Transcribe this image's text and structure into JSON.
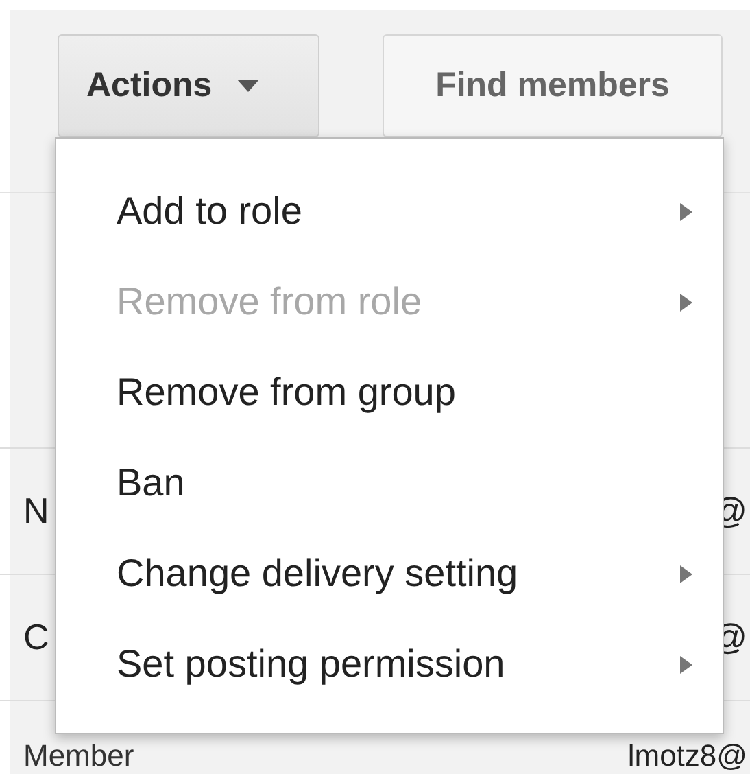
{
  "toolbar": {
    "buttons": [
      {
        "kind": "dropdown",
        "label": "Actions",
        "selected": true
      },
      {
        "kind": "plain",
        "label": "Find members",
        "selected": false
      }
    ]
  },
  "menu": {
    "items": [
      {
        "label": "Add to role",
        "disabled": false,
        "submenu": true
      },
      {
        "label": "Remove from role",
        "disabled": true,
        "submenu": true
      },
      {
        "label": "Remove from group",
        "disabled": false,
        "submenu": false
      },
      {
        "label": "Ban",
        "disabled": false,
        "submenu": false
      },
      {
        "label": "Change delivery setting",
        "disabled": false,
        "submenu": true
      },
      {
        "label": "Set posting permission",
        "disabled": false,
        "submenu": true
      }
    ]
  },
  "table": {
    "rows": [
      {
        "column_1": "N",
        "column_2": "@"
      },
      {
        "column_1": "C",
        "column_2": "@"
      },
      {
        "column_1": "Member",
        "column_2": "lmotz8@"
      }
    ]
  }
}
